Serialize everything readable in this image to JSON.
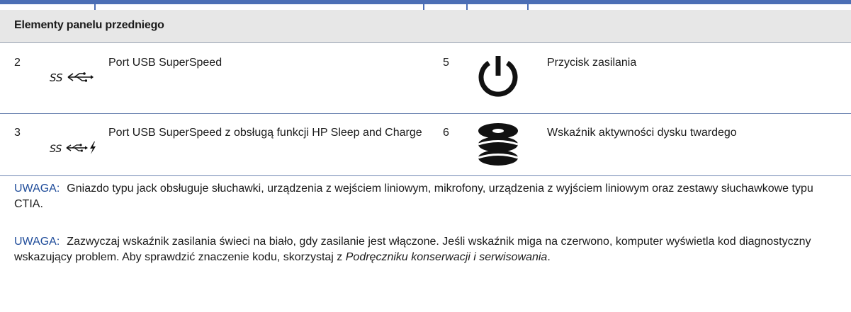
{
  "table": {
    "title": "Elementy panelu przedniego",
    "rows": [
      {
        "left": {
          "number": "2",
          "icon": "usb-superspeed-icon",
          "label": "Port USB SuperSpeed"
        },
        "right": {
          "number": "5",
          "icon": "power-button-icon",
          "label": "Przycisk zasilania"
        }
      },
      {
        "left": {
          "number": "3",
          "icon": "usb-sleep-charge-icon",
          "label": "Port USB SuperSpeed z obsługą funkcji HP Sleep and Charge"
        },
        "right": {
          "number": "6",
          "icon": "hard-drive-activity-icon",
          "label": "Wskaźnik aktywności dysku twardego"
        }
      }
    ]
  },
  "notes": [
    {
      "label": "UWAGA:",
      "text": "Gniazdo typu jack obsługuje słuchawki, urządzenia z wejściem liniowym, mikrofony, urządzenia z wyjściem liniowym oraz zestawy słuchawkowe typu CTIA."
    },
    {
      "label": "UWAGA:",
      "text": "Zazwyczaj wskaźnik zasilania świeci na biało, gdy zasilanie jest włączone. Jeśli wskaźnik miga na czerwono, komputer wyświetla kod diagnostyczny wskazujący problem. Aby sprawdzić znaczenie kodu, skorzystaj z ",
      "link_text": "Podręczniku konserwacji i serwisowania",
      "suffix": "."
    }
  ],
  "colors": {
    "accent": "#4c6fb5",
    "label": "#1f4c9a",
    "header_bg": "#e7e7e7"
  }
}
